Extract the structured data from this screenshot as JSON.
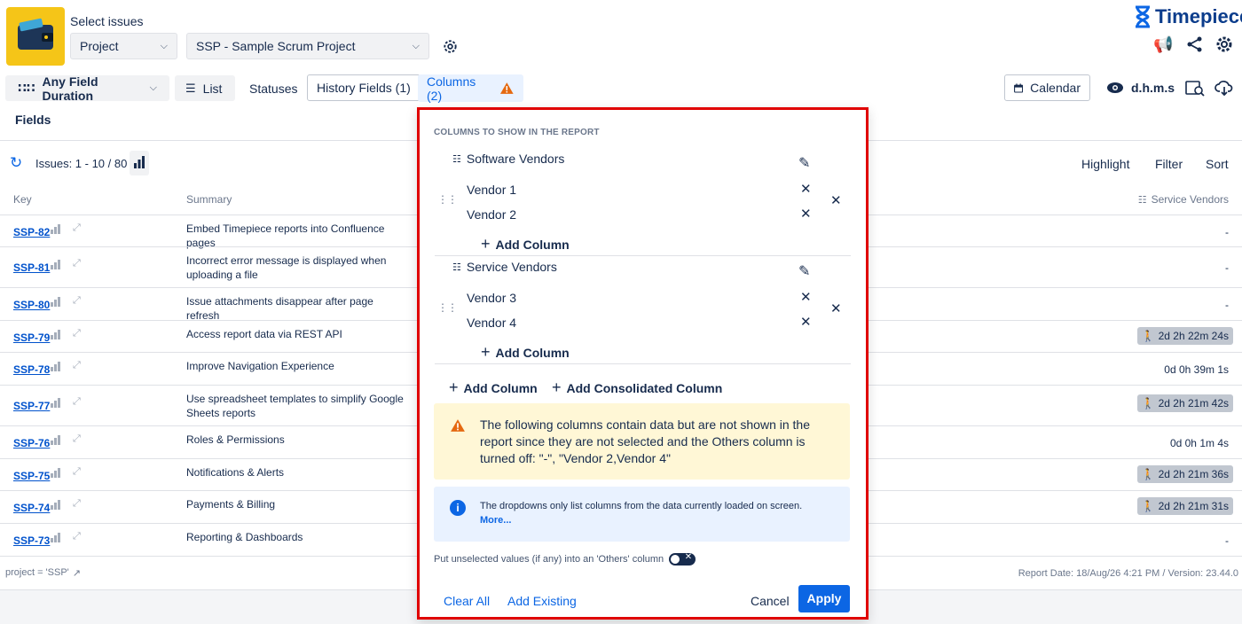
{
  "header": {
    "select_issues": "Select issues",
    "project_select": "Project",
    "project_value": "SSP - Sample Scrum Project",
    "brand": "Timepiece"
  },
  "toolbar": {
    "any_field_duration": "Any Field Duration",
    "list": "List",
    "statuses": "Statuses",
    "history_fields": "History Fields (1)",
    "columns": "Columns (2)",
    "fields": "Fields",
    "calendar": "Calendar",
    "dhms": "d.h.m.s"
  },
  "results": {
    "issues": "Issues: 1 - 10 / 80",
    "highlight": "Highlight",
    "filter": "Filter",
    "sort": "Sort"
  },
  "table": {
    "headers": {
      "key": "Key",
      "summary": "Summary",
      "service_vendors": "Service Vendors"
    },
    "rows": [
      {
        "key": "SSP-82",
        "summary": "Embed Timepiece reports into Confluence pages",
        "value": "-",
        "chip": false
      },
      {
        "key": "SSP-81",
        "summary": "Incorrect error message is displayed when uploading a file",
        "value": "-",
        "chip": false
      },
      {
        "key": "SSP-80",
        "summary": "Issue attachments disappear after page refresh",
        "value": "-",
        "chip": false
      },
      {
        "key": "SSP-79",
        "summary": "Access report data via REST API",
        "value": "2d 2h 22m 24s",
        "chip": true
      },
      {
        "key": "SSP-78",
        "summary": "Improve Navigation Experience",
        "value": "0d 0h 39m 1s",
        "chip": false
      },
      {
        "key": "SSP-77",
        "summary": "Use spreadsheet templates to simplify Google Sheets reports",
        "value": "2d 2h 21m 42s",
        "chip": true
      },
      {
        "key": "SSP-76",
        "summary": "Roles & Permissions",
        "value": "0d 0h 1m 4s",
        "chip": false
      },
      {
        "key": "SSP-75",
        "summary": "Notifications & Alerts",
        "value": "2d 2h 21m 36s",
        "chip": true
      },
      {
        "key": "SSP-74",
        "summary": "Payments & Billing",
        "value": "2d 2h 21m 31s",
        "chip": true
      },
      {
        "key": "SSP-73",
        "summary": "Reporting & Dashboards",
        "value": "-",
        "chip": false
      }
    ]
  },
  "footer": {
    "jql": "project = 'SSP'",
    "report_date": "Report Date: 18/Aug/26 4:21 PM / Version: 23.44.0"
  },
  "panel": {
    "heading": "COLUMNS TO SHOW IN THE REPORT",
    "groups": [
      {
        "name": "Software Vendors",
        "items": [
          "Vendor 1",
          "Vendor 2"
        ],
        "add": "Add Column"
      },
      {
        "name": "Service Vendors",
        "items": [
          "Vendor 3",
          "Vendor 4"
        ],
        "add": "Add Column"
      }
    ],
    "add_column": "Add Column",
    "add_consolidated": "Add Consolidated Column",
    "warning": "The following columns contain data but are not shown in the report since they are not selected and the Others column is turned off: \"-\", \"Vendor 2,Vendor 4\"",
    "info": "The dropdowns only list columns from the data currently loaded on screen.",
    "info_more": "More...",
    "others_label": "Put unselected values (if any) into an 'Others' column",
    "clear_all": "Clear All",
    "add_existing": "Add Existing",
    "cancel": "Cancel",
    "apply": "Apply",
    "colors": {
      "accent": "#0c66e4",
      "warning_bg": "#fff7d6",
      "info_bg": "#e9f2ff",
      "warning_icon": "#e56910"
    }
  }
}
